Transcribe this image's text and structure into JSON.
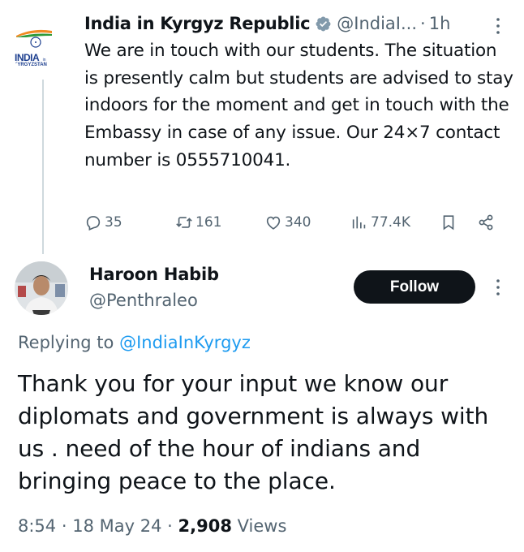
{
  "parent_tweet": {
    "author_name": "India in Kyrgyz Republic",
    "author_handle": "@IndiaI...",
    "separator": "·",
    "time": "1h",
    "avatar": {
      "logo_text": "INDIA",
      "logo_small": "in",
      "logo_sub": "KYRGYZSTAN"
    },
    "text": "We are in touch with our students. The situation is presently calm but students are advised to stay indoors for the moment and get in touch with the Embassy in case of any issue. Our 24×7 contact number is 0555710041.",
    "actions": {
      "replies": "35",
      "reposts": "161",
      "likes": "340",
      "views": "77.4K"
    }
  },
  "reply_tweet": {
    "author_name": "Haroon Habib",
    "author_handle": "@Penthraleo",
    "follow_label": "Follow",
    "replying_prefix": "Replying to",
    "replying_to": "@IndiaInKyrgyz",
    "text": "Thank you for your input we know our diplomats and government is always with us . need of the hour of indians and bringing peace to the place.",
    "time": "8:54",
    "date": "18 May 24",
    "separator": "·",
    "views_count": "2,908",
    "views_label": "Views"
  },
  "colors": {
    "text_primary": "#0f1419",
    "text_secondary": "#536471",
    "accent": "#1d9bf0",
    "verified_badge": "#829aab",
    "follow_bg": "#0f1419"
  },
  "icons": [
    "verified-badge-icon",
    "more-options-icon",
    "reply-icon",
    "repost-icon",
    "like-icon",
    "views-icon",
    "bookmark-icon",
    "share-icon"
  ]
}
